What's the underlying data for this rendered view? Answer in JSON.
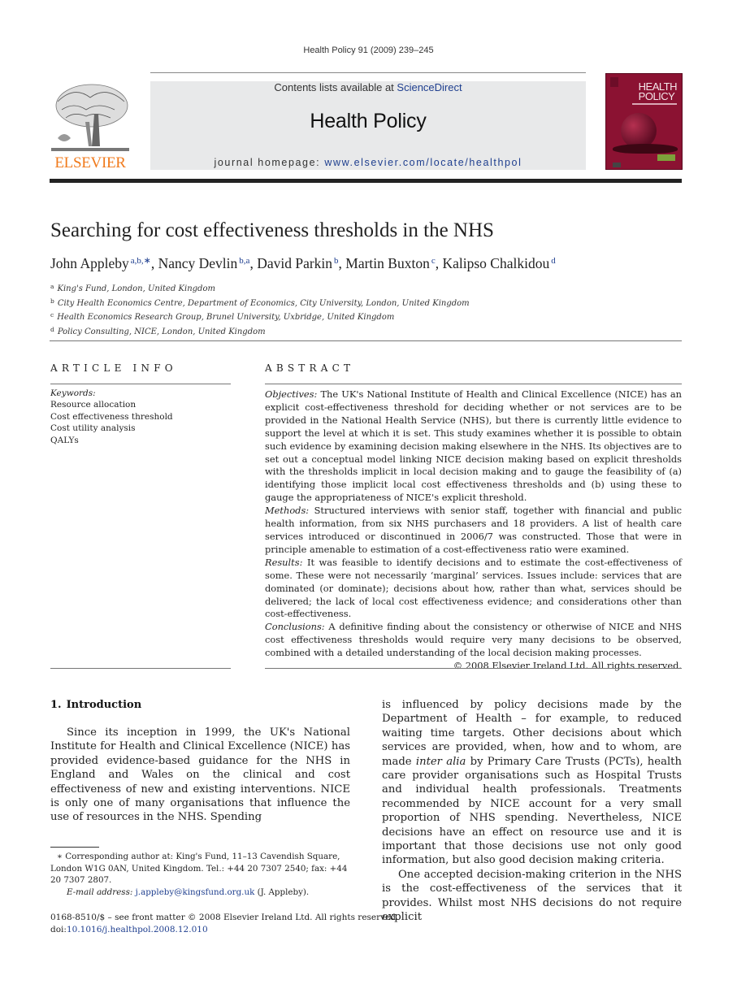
{
  "running_head": "Health Policy 91 (2009) 239–245",
  "banner": {
    "contents_prefix": "Contents lists available at ",
    "contents_link": "ScienceDirect",
    "journal_title": "Health Policy",
    "homepage_prefix": "journal homepage: ",
    "homepage_link": "www.elsevier.com/locate/healthpol"
  },
  "publisher_logo": {
    "wordmark": "ELSEVIER",
    "icon": "elsevier-tree-icon",
    "color": "#f07a1c"
  },
  "cover": {
    "title_line1": "HEALTH",
    "title_line2": "POLICY",
    "color": "#8b1232"
  },
  "article": {
    "title": "Searching for cost effectiveness thresholds in the NHS",
    "authors": [
      {
        "name": "John Appleby",
        "affil": "a,b,∗",
        "sep": ", "
      },
      {
        "name": "Nancy Devlin",
        "affil": "b,a",
        "sep": ", "
      },
      {
        "name": "David Parkin",
        "affil": "b",
        "sep": ", "
      },
      {
        "name": "Martin Buxton",
        "affil": "c",
        "sep": ", "
      },
      {
        "name": "Kalipso Chalkidou",
        "affil": "d",
        "sep": ""
      }
    ],
    "affiliations": [
      {
        "mark": "a",
        "text": "King's Fund, London, United Kingdom"
      },
      {
        "mark": "b",
        "text": "City Health Economics Centre, Department of Economics, City University, London, United Kingdom"
      },
      {
        "mark": "c",
        "text": "Health Economics Research Group, Brunel University, Uxbridge, United Kingdom"
      },
      {
        "mark": "d",
        "text": "Policy Consulting, NICE, London, United Kingdom"
      }
    ]
  },
  "article_info": {
    "heading": "ARTICLE INFO",
    "keywords_label": "Keywords:",
    "keywords": [
      "Resource allocation",
      "Cost effectiveness threshold",
      "Cost utility analysis",
      "QALYs"
    ]
  },
  "abstract": {
    "heading": "ABSTRACT",
    "sections": [
      {
        "label": "Objectives:",
        "text": " The UK's National Institute of Health and Clinical Excellence (NICE) has an explicit cost-effectiveness threshold for deciding whether or not services are to be provided in the National Health Service (NHS), but there is currently little evidence to support the level at which it is set. This study examines whether it is possible to obtain such evidence by examining decision making elsewhere in the NHS. Its objectives are to set out a conceptual model linking NICE decision making based on explicit thresholds with the thresholds implicit in local decision making and to gauge the feasibility of (a) identifying those implicit local cost effectiveness thresholds and (b) using these to gauge the appropriateness of NICE's explicit threshold."
      },
      {
        "label": "Methods:",
        "text": " Structured interviews with senior staff, together with financial and public health information, from six NHS purchasers and 18 providers. A list of health care services introduced or discontinued in 2006/7 was constructed. Those that were in principle amenable to estimation of a cost-effectiveness ratio were examined."
      },
      {
        "label": "Results:",
        "text": " It was feasible to identify decisions and to estimate the cost-effectiveness of some. These were not necessarily ‘marginal’ services. Issues include: services that are dominated (or dominate); decisions about how, rather than what, services should be delivered; the lack of local cost effectiveness evidence; and considerations other than cost-effectiveness."
      },
      {
        "label": "Conclusions:",
        "text": " A definitive finding about the consistency or otherwise of NICE and NHS cost effectiveness thresholds would require very many decisions to be observed, combined with a detailed understanding of the local decision making processes."
      }
    ],
    "copyright": "© 2008 Elsevier Ireland Ltd. All rights reserved."
  },
  "introduction": {
    "number": "1.",
    "heading": "Introduction",
    "left_paragraph": "Since its inception in 1999, the UK's National Institute for Health and Clinical Excellence (NICE) has provided evidence-based guidance for the NHS in England and Wales on the clinical and cost effectiveness of new and existing interventions. NICE is only one of many organisations that influence the use of resources in the NHS. Spending",
    "right_p1_a": "is influenced by policy decisions made by the Department of Health – for example, to reduced waiting time targets. Other decisions about which services are provided, when, how and to whom, are made ",
    "right_p1_em": "inter alia",
    "right_p1_b": " by Primary Care Trusts (PCTs), health care provider organisations such as Hospital Trusts and individual health professionals. Treatments recommended by NICE account for a very small proportion of NHS spending. Nevertheless, NICE decisions have an effect on resource use and it is important that those decisions use not only good information, but also good decision making criteria.",
    "right_p2": "One accepted decision-making criterion in the NHS is the cost-effectiveness of the services that it provides. Whilst most NHS decisions do not require explicit"
  },
  "footnote": {
    "mark": "∗",
    "text": "Corresponding author at: King's Fund, 11–13 Cavendish Square, London W1G 0AN, United Kingdom. Tel.: +44 20 7307 2540; fax: +44 20 7307 2807.",
    "email_label": "E-mail address:",
    "email": "j.appleby@kingsfund.org.uk",
    "email_suffix": " (J. Appleby)."
  },
  "front_matter": {
    "issn_line": "0168-8510/$ – see front matter © 2008 Elsevier Ireland Ltd. All rights reserved.",
    "doi_label": "doi:",
    "doi": "10.1016/j.healthpol.2008.12.010"
  }
}
